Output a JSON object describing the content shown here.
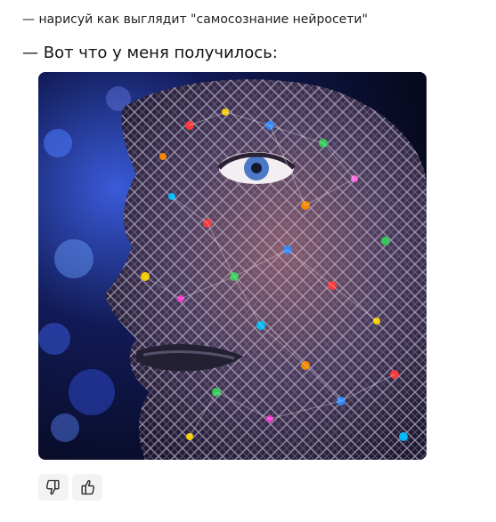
{
  "chat": {
    "user_message": "— нарисуй как выглядит \"самосознание нейросети\"",
    "bot_message": "— Вот что у меня получилось:"
  },
  "image": {
    "icon": "ai-face-neural-network-image"
  },
  "feedback": {
    "dislike_icon": "thumbs-down-icon",
    "like_icon": "thumbs-up-icon"
  }
}
